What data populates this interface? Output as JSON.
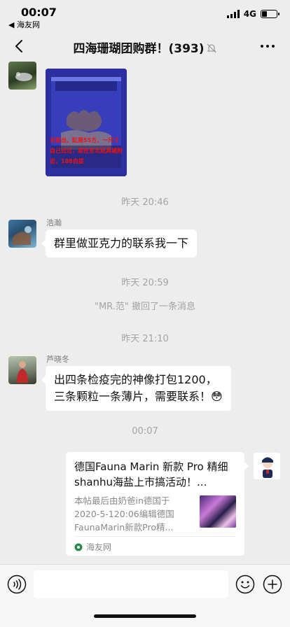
{
  "status_bar": {
    "time": "00:07",
    "back_app": "◀ 海友网",
    "network": "4G",
    "battery_level": 0.3
  },
  "nav": {
    "title": "四海珊瑚团购群！(393)"
  },
  "messages": {
    "image_caption": "对家出，缸是55方，一尺寸自己过过，就在东北玩具城附近，188自提",
    "time_1": "昨天 20:46",
    "msg1_sender": "浩瀚",
    "msg1_text": "群里做亚克力的联系我一下",
    "time_2": "昨天 20:59",
    "system_recall": "\"MR.范\" 撤回了一条消息",
    "time_3": "昨天 21:10",
    "msg2_sender": "芦晓冬",
    "msg2_line1": "出四条检疫完的神像打包1200，",
    "msg2_line2": "三条颗粒一条薄片，需要联系！😳",
    "time_4": "00:07"
  },
  "link_card": {
    "title": "德国Fauna Marin 新款 Pro 精细shanhu海盐上市搞活动！...",
    "description": "本帖最后由奶爸in德国于2020-5-120:06编辑德国FaunaMarin新款Pro精...",
    "source": "海友网"
  },
  "input_bar": {
    "placeholder": ""
  },
  "colors": {
    "chat_bg": "#ededed",
    "bubble": "#ffffff",
    "timestamp": "#a3a3a3"
  }
}
